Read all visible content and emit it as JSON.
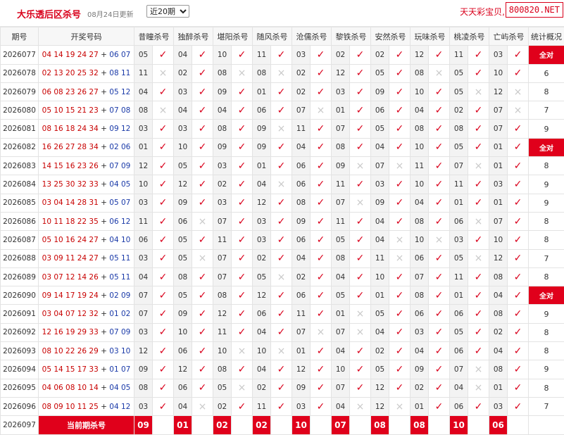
{
  "header": {
    "title": "大乐透后区杀号",
    "updated": "08月24日更新",
    "period_options": [
      "近20期"
    ],
    "period_selected": "近20期",
    "brand": "天天彩宝贝,",
    "domain": "800820.NET"
  },
  "columns": [
    "期号",
    "开奖号码",
    "昔瞳杀号",
    "独醉杀号",
    "堪阳杀号",
    "随风杀号",
    "沧儒杀号",
    "黎铁杀号",
    "安然杀号",
    "玩味杀号",
    "桃凌杀号",
    "亡屿杀号",
    "统计概况"
  ],
  "rows": [
    {
      "period": "2026077",
      "front": "04 14 19 24 27",
      "back": "06 07",
      "kills": [
        [
          "05",
          "y"
        ],
        [
          "04",
          "y"
        ],
        [
          "10",
          "y"
        ],
        [
          "11",
          "y"
        ],
        [
          "03",
          "y"
        ],
        [
          "02",
          "y"
        ],
        [
          "02",
          "y"
        ],
        [
          "12",
          "y"
        ],
        [
          "11",
          "y"
        ],
        [
          "03",
          "y"
        ]
      ],
      "stat": "全对"
    },
    {
      "period": "2026078",
      "front": "02 13 20 25 32",
      "back": "08 11",
      "kills": [
        [
          "11",
          "n"
        ],
        [
          "02",
          "y"
        ],
        [
          "08",
          "n"
        ],
        [
          "08",
          "n"
        ],
        [
          "02",
          "y"
        ],
        [
          "12",
          "y"
        ],
        [
          "05",
          "y"
        ],
        [
          "08",
          "n"
        ],
        [
          "05",
          "y"
        ],
        [
          "10",
          "y"
        ]
      ],
      "stat": "6"
    },
    {
      "period": "2026079",
      "front": "06 08 23 26 27",
      "back": "05 12",
      "kills": [
        [
          "04",
          "y"
        ],
        [
          "03",
          "y"
        ],
        [
          "09",
          "y"
        ],
        [
          "01",
          "y"
        ],
        [
          "02",
          "y"
        ],
        [
          "03",
          "y"
        ],
        [
          "09",
          "y"
        ],
        [
          "10",
          "y"
        ],
        [
          "05",
          "n"
        ],
        [
          "12",
          "n"
        ]
      ],
      "stat": "8"
    },
    {
      "period": "2026080",
      "front": "05 10 15 21 23",
      "back": "07 08",
      "kills": [
        [
          "08",
          "n"
        ],
        [
          "04",
          "y"
        ],
        [
          "04",
          "y"
        ],
        [
          "06",
          "y"
        ],
        [
          "07",
          "n"
        ],
        [
          "01",
          "y"
        ],
        [
          "06",
          "y"
        ],
        [
          "04",
          "y"
        ],
        [
          "02",
          "y"
        ],
        [
          "07",
          "n"
        ]
      ],
      "stat": "7"
    },
    {
      "period": "2026081",
      "front": "08 16 18 24 34",
      "back": "09 12",
      "kills": [
        [
          "03",
          "y"
        ],
        [
          "03",
          "y"
        ],
        [
          "08",
          "y"
        ],
        [
          "09",
          "n"
        ],
        [
          "11",
          "y"
        ],
        [
          "07",
          "y"
        ],
        [
          "05",
          "y"
        ],
        [
          "08",
          "y"
        ],
        [
          "08",
          "y"
        ],
        [
          "07",
          "y"
        ]
      ],
      "stat": "9"
    },
    {
      "period": "2026082",
      "front": "16 26 27 28 34",
      "back": "02 06",
      "kills": [
        [
          "01",
          "y"
        ],
        [
          "10",
          "y"
        ],
        [
          "09",
          "y"
        ],
        [
          "09",
          "y"
        ],
        [
          "04",
          "y"
        ],
        [
          "08",
          "y"
        ],
        [
          "04",
          "y"
        ],
        [
          "10",
          "y"
        ],
        [
          "05",
          "y"
        ],
        [
          "01",
          "y"
        ]
      ],
      "stat": "全对"
    },
    {
      "period": "2026083",
      "front": "14 15 16 23 26",
      "back": "07 09",
      "kills": [
        [
          "12",
          "y"
        ],
        [
          "05",
          "y"
        ],
        [
          "03",
          "y"
        ],
        [
          "01",
          "y"
        ],
        [
          "06",
          "y"
        ],
        [
          "09",
          "n"
        ],
        [
          "07",
          "n"
        ],
        [
          "11",
          "y"
        ],
        [
          "07",
          "n"
        ],
        [
          "01",
          "y"
        ]
      ],
      "stat": "8"
    },
    {
      "period": "2026084",
      "front": "13 25 30 32 33",
      "back": "04 05",
      "kills": [
        [
          "10",
          "y"
        ],
        [
          "12",
          "y"
        ],
        [
          "02",
          "y"
        ],
        [
          "04",
          "n"
        ],
        [
          "06",
          "y"
        ],
        [
          "11",
          "y"
        ],
        [
          "03",
          "y"
        ],
        [
          "10",
          "y"
        ],
        [
          "11",
          "y"
        ],
        [
          "03",
          "y"
        ]
      ],
      "stat": "9"
    },
    {
      "period": "2026085",
      "front": "03 04 14 28 31",
      "back": "05 07",
      "kills": [
        [
          "03",
          "y"
        ],
        [
          "09",
          "y"
        ],
        [
          "03",
          "y"
        ],
        [
          "12",
          "y"
        ],
        [
          "08",
          "y"
        ],
        [
          "07",
          "n"
        ],
        [
          "09",
          "y"
        ],
        [
          "04",
          "y"
        ],
        [
          "01",
          "y"
        ],
        [
          "01",
          "y"
        ]
      ],
      "stat": "9"
    },
    {
      "period": "2026086",
      "front": "10 11 18 22 35",
      "back": "06 12",
      "kills": [
        [
          "11",
          "y"
        ],
        [
          "06",
          "n"
        ],
        [
          "07",
          "y"
        ],
        [
          "03",
          "y"
        ],
        [
          "09",
          "y"
        ],
        [
          "11",
          "y"
        ],
        [
          "04",
          "y"
        ],
        [
          "08",
          "y"
        ],
        [
          "06",
          "n"
        ],
        [
          "07",
          "y"
        ]
      ],
      "stat": "8"
    },
    {
      "period": "2026087",
      "front": "05 10 16 24 27",
      "back": "04 10",
      "kills": [
        [
          "06",
          "y"
        ],
        [
          "05",
          "y"
        ],
        [
          "11",
          "y"
        ],
        [
          "03",
          "y"
        ],
        [
          "06",
          "y"
        ],
        [
          "05",
          "y"
        ],
        [
          "04",
          "n"
        ],
        [
          "10",
          "n"
        ],
        [
          "03",
          "y"
        ],
        [
          "10",
          "y"
        ]
      ],
      "stat": "8"
    },
    {
      "period": "2026088",
      "front": "03 09 11 24 27",
      "back": "05 11",
      "kills": [
        [
          "03",
          "y"
        ],
        [
          "05",
          "n"
        ],
        [
          "07",
          "y"
        ],
        [
          "02",
          "y"
        ],
        [
          "04",
          "y"
        ],
        [
          "08",
          "y"
        ],
        [
          "11",
          "n"
        ],
        [
          "06",
          "y"
        ],
        [
          "05",
          "n"
        ],
        [
          "12",
          "y"
        ]
      ],
      "stat": "7"
    },
    {
      "period": "2026089",
      "front": "03 07 12 14 26",
      "back": "05 11",
      "kills": [
        [
          "04",
          "y"
        ],
        [
          "08",
          "y"
        ],
        [
          "07",
          "y"
        ],
        [
          "05",
          "n"
        ],
        [
          "02",
          "y"
        ],
        [
          "04",
          "y"
        ],
        [
          "10",
          "y"
        ],
        [
          "07",
          "y"
        ],
        [
          "11",
          "y"
        ],
        [
          "08",
          "y"
        ]
      ],
      "stat": "8"
    },
    {
      "period": "2026090",
      "front": "09 14 17 19 24",
      "back": "02 09",
      "kills": [
        [
          "07",
          "y"
        ],
        [
          "05",
          "y"
        ],
        [
          "08",
          "y"
        ],
        [
          "12",
          "y"
        ],
        [
          "06",
          "y"
        ],
        [
          "05",
          "y"
        ],
        [
          "01",
          "y"
        ],
        [
          "08",
          "y"
        ],
        [
          "01",
          "y"
        ],
        [
          "04",
          "y"
        ]
      ],
      "stat": "全对"
    },
    {
      "period": "2026091",
      "front": "03 04 07 12 32",
      "back": "01 02",
      "kills": [
        [
          "07",
          "y"
        ],
        [
          "09",
          "y"
        ],
        [
          "12",
          "y"
        ],
        [
          "06",
          "y"
        ],
        [
          "11",
          "y"
        ],
        [
          "01",
          "n"
        ],
        [
          "05",
          "y"
        ],
        [
          "06",
          "y"
        ],
        [
          "06",
          "y"
        ],
        [
          "08",
          "y"
        ]
      ],
      "stat": "9"
    },
    {
      "period": "2026092",
      "front": "12 16 19 29 33",
      "back": "07 09",
      "kills": [
        [
          "03",
          "y"
        ],
        [
          "10",
          "y"
        ],
        [
          "11",
          "y"
        ],
        [
          "04",
          "y"
        ],
        [
          "07",
          "n"
        ],
        [
          "07",
          "n"
        ],
        [
          "04",
          "y"
        ],
        [
          "03",
          "y"
        ],
        [
          "05",
          "y"
        ],
        [
          "02",
          "y"
        ]
      ],
      "stat": "8"
    },
    {
      "period": "2026093",
      "front": "08 10 22 26 29",
      "back": "03 10",
      "kills": [
        [
          "12",
          "y"
        ],
        [
          "06",
          "y"
        ],
        [
          "10",
          "n"
        ],
        [
          "10",
          "n"
        ],
        [
          "01",
          "y"
        ],
        [
          "04",
          "y"
        ],
        [
          "02",
          "y"
        ],
        [
          "04",
          "y"
        ],
        [
          "06",
          "y"
        ],
        [
          "04",
          "y"
        ]
      ],
      "stat": "8"
    },
    {
      "period": "2026094",
      "front": "05 14 15 17 33",
      "back": "01 07",
      "kills": [
        [
          "09",
          "y"
        ],
        [
          "12",
          "y"
        ],
        [
          "08",
          "y"
        ],
        [
          "04",
          "y"
        ],
        [
          "12",
          "y"
        ],
        [
          "10",
          "y"
        ],
        [
          "05",
          "y"
        ],
        [
          "09",
          "y"
        ],
        [
          "07",
          "n"
        ],
        [
          "08",
          "y"
        ]
      ],
      "stat": "9"
    },
    {
      "period": "2026095",
      "front": "04 06 08 10 14",
      "back": "04 05",
      "kills": [
        [
          "08",
          "y"
        ],
        [
          "06",
          "y"
        ],
        [
          "05",
          "n"
        ],
        [
          "02",
          "y"
        ],
        [
          "09",
          "y"
        ],
        [
          "07",
          "y"
        ],
        [
          "12",
          "y"
        ],
        [
          "02",
          "y"
        ],
        [
          "04",
          "n"
        ],
        [
          "01",
          "y"
        ]
      ],
      "stat": "8"
    },
    {
      "period": "2026096",
      "front": "08 09 10 11 25",
      "back": "04 12",
      "kills": [
        [
          "03",
          "y"
        ],
        [
          "04",
          "n"
        ],
        [
          "02",
          "y"
        ],
        [
          "11",
          "y"
        ],
        [
          "03",
          "y"
        ],
        [
          "04",
          "n"
        ],
        [
          "12",
          "n"
        ],
        [
          "01",
          "y"
        ],
        [
          "06",
          "y"
        ],
        [
          "03",
          "y"
        ]
      ],
      "stat": "7"
    }
  ],
  "current": {
    "period": "2026097",
    "label": "当前期杀号",
    "kills": [
      "09",
      "01",
      "02",
      "02",
      "10",
      "07",
      "08",
      "08",
      "10",
      "06"
    ]
  },
  "marks": {
    "ok": "✓",
    "no": "×"
  },
  "colors": {
    "accent": "#e0001b",
    "front": "#c80000",
    "back": "#1a3aa8"
  }
}
